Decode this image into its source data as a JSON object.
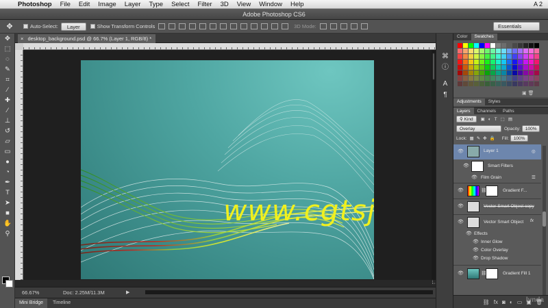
{
  "menubar": {
    "apple": "",
    "items": [
      "Photoshop",
      "File",
      "Edit",
      "Image",
      "Layer",
      "Type",
      "Select",
      "Filter",
      "3D",
      "View",
      "Window",
      "Help"
    ],
    "right": "A 2"
  },
  "window": {
    "title": "Adobe Photoshop CS6"
  },
  "options": {
    "tool_icon": "move-tool-icon",
    "auto_select_label": "Auto-Select:",
    "auto_select_value": "Layer",
    "transform_label": "Show Transform Controls",
    "mode_3d_label": "3D Mode:",
    "workspace": "Essentials"
  },
  "document": {
    "tab_title": "desktop_background.psd @ 66.7% (Layer 1, RGB/8) *",
    "watermark": "www.cgtsj.com",
    "zoom": "66.67%",
    "doc_size": "Doc: 2.25M/11.3M"
  },
  "bottom_tabs": [
    "Mini Bridge",
    "Timeline"
  ],
  "panels": {
    "color_tabs": [
      "Color",
      "Swatches"
    ],
    "adjust_tabs": [
      "Adjustments",
      "Styles"
    ],
    "layer_tabs": [
      "Layers",
      "Channels",
      "Paths"
    ],
    "kind_label": "Kind",
    "blend_mode": "Overlay",
    "opacity_label": "Opacity:",
    "opacity_value": "100%",
    "lock_label": "Lock:",
    "fill_label": "Fill:",
    "fill_value": "100%",
    "layers": [
      {
        "name": "Layer 1"
      },
      {
        "name": "Smart Filters"
      },
      {
        "name": "Film Grain"
      },
      {
        "name": "Gradient F..."
      },
      {
        "name": "Vector Smart Object copy"
      },
      {
        "name": "Vector Smart Object"
      },
      {
        "name": "Effects"
      },
      {
        "name": "Inner Glow"
      },
      {
        "name": "Color Overlay"
      },
      {
        "name": "Drop Shadow"
      },
      {
        "name": "Gradient Fill 1"
      }
    ]
  },
  "colors": {
    "accent_selected_layer": "#6d86ad",
    "watermark": "#f0f01e",
    "canvas_teal": "#4fa6a2"
  }
}
